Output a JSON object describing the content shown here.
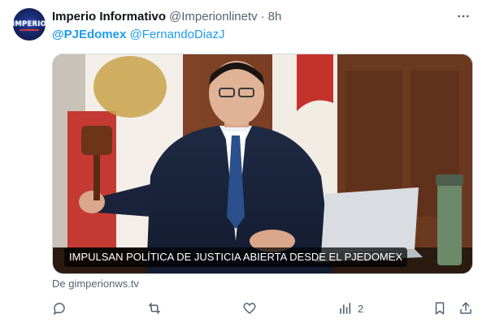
{
  "tweet": {
    "author_name": "Imperio Informativo",
    "author_handle": "@Imperionlinetv",
    "separator": "·",
    "time": "8h",
    "mentions": [
      "@PJEdomex",
      "@FernandoDiazJ"
    ],
    "avatar_text": "IMPERIO"
  },
  "card": {
    "caption": "IMPULSAN POLÍTICA DE JUSTICIA ABIERTA DESDE EL PJEDOMEX",
    "source": "De gimperionws.tv"
  },
  "actions": {
    "views_count": "2"
  },
  "icons": {
    "more": "more-horizontal-icon",
    "reply": "reply-icon",
    "retweet": "retweet-icon",
    "like": "like-icon",
    "views": "views-icon",
    "bookmark": "bookmark-icon",
    "share": "share-icon"
  },
  "colors": {
    "link": "#1d9bf0",
    "muted": "#536471",
    "text": "#0f1419"
  }
}
